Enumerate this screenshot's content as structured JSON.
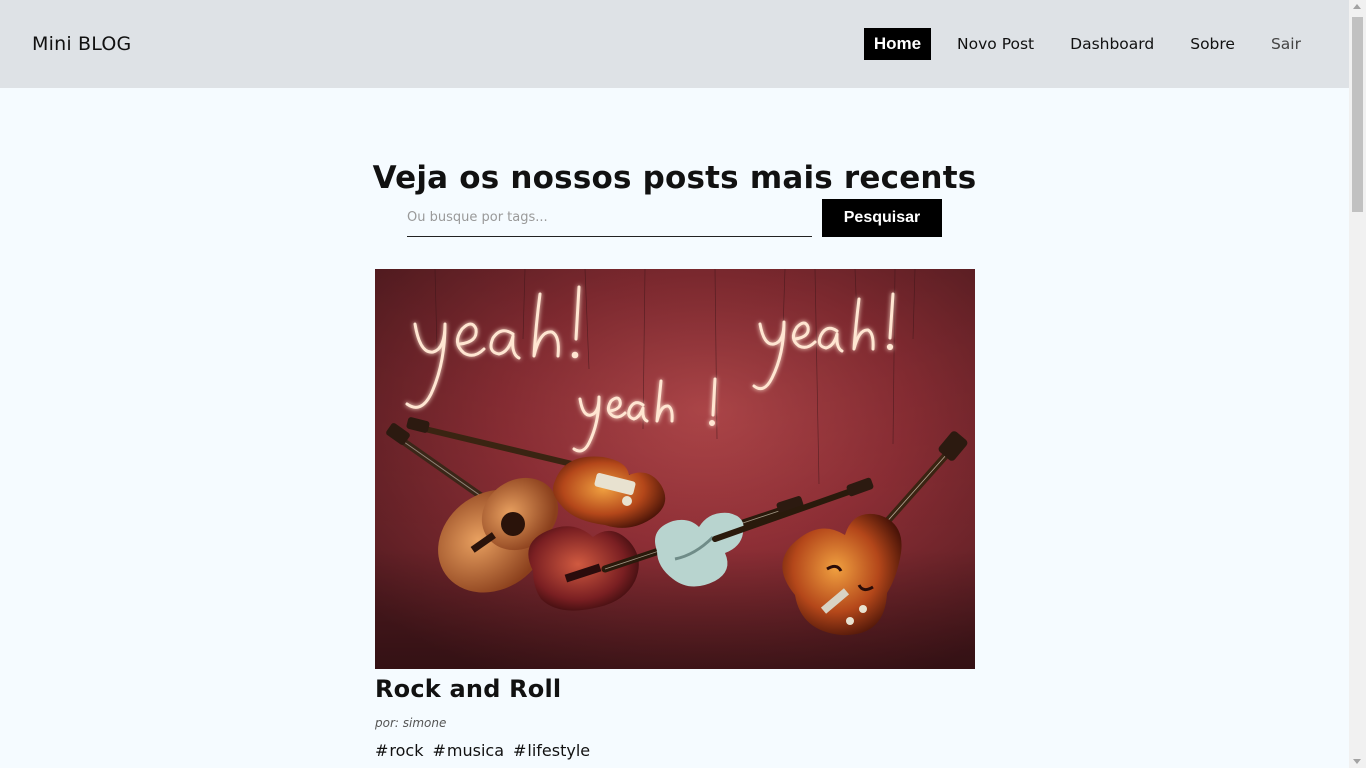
{
  "navbar": {
    "brand": "Mini BLOG",
    "links": [
      {
        "label": "Home",
        "active": true
      },
      {
        "label": "Novo Post"
      },
      {
        "label": "Dashboard"
      },
      {
        "label": "Sobre"
      }
    ],
    "logout": "Sair"
  },
  "home": {
    "title": "Veja os nossos posts mais recents",
    "search_placeholder": "Ou busque por tags...",
    "search_button": "Pesquisar"
  },
  "post": {
    "title": "Rock and Roll",
    "author": "por: simone",
    "image_alt": "Rock and Roll",
    "neon_text": [
      "yeah!",
      "yeah!",
      "yeah!"
    ],
    "tags": [
      "rock",
      "musica",
      "lifestyle"
    ]
  },
  "colors": {
    "navbar_bg": "#dee2e6",
    "page_bg": "#f5fbff",
    "accent": "#000000"
  }
}
